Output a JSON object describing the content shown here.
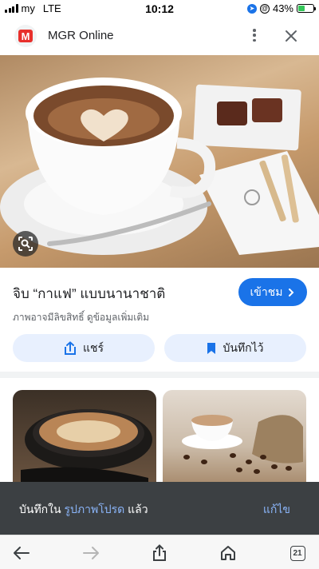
{
  "status_bar": {
    "carrier": "my",
    "network": "LTE",
    "time": "10:12",
    "battery": "43%",
    "battery_level": 0.43
  },
  "header": {
    "logo_letter": "M",
    "site_name": "MGR Online",
    "menu_icon": "kebab-menu-icon",
    "close_icon": "close-icon"
  },
  "image": {
    "lens_icon": "visual-search-icon"
  },
  "details": {
    "title": "จิบ “กาแฟ” แบบนานาชาติ",
    "visit_label": "เข้าชม",
    "copyright": "ภาพอาจมีลิขสิทธิ์ ดูข้อมูลเพิ่มเติม",
    "share_label": "แชร์",
    "save_label": "บันทึกไว้"
  },
  "snackbar": {
    "text_before": "บันทึกใน ",
    "link": "รูปภาพโปรด",
    "text_after": " แล้ว",
    "action": "แก้ไข"
  },
  "toolbar": {
    "tab_count": "21"
  },
  "colors": {
    "accent": "#1a73e8",
    "chip_bg": "#e8f0fe",
    "snackbar_bg": "#3c4043",
    "snackbar_link": "#8ab4f8",
    "logo_red": "#e8302c"
  }
}
